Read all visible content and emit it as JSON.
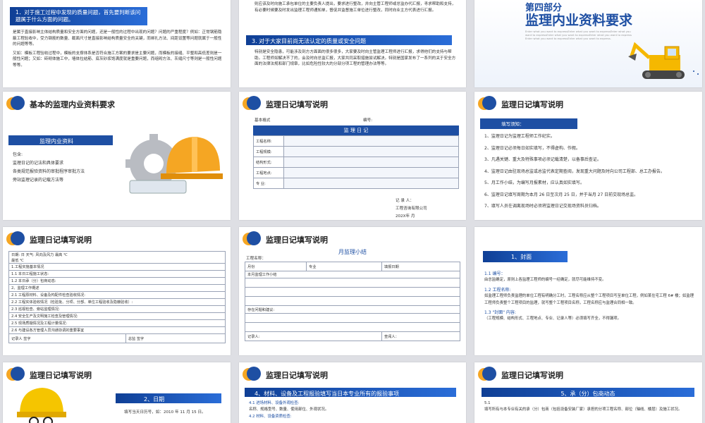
{
  "s1": {
    "heading": "1．对于施工过程中发现的质量问题，首先要判断该问题属于什么方面的问题。",
    "bullets": [
      "是属于直接影响主体结构质量和安全方面的问题，还是一般性的过程中出现的问题？问题的严重程度？例如：正常钢筋隐蔽工程验收中，受力钢筋的数量、截面尺寸是直接影响结构质量安全的关键，而绑扎方法、间距设置等问题就属于一般性的问题等等。",
      "又如：模板工程验收过程中，模板的支撑体系是否符合施工方案的要求是主要问题，而模板的接缝、平整和高低差则是一般性问题；又如：砖砌体施工中，墙体拉结筋、底灰砂浆饱满度就是重要问题，而组砌方法、灰缝尺寸等则是一般性问题等等。"
    ]
  },
  "s2": {
    "top_text": "则应该及时向施工承包单位的主要负责人提出，要求进行整改，并向主管工程师或总监办代汇报，寻求帮助和支持，有必要时候要及时发出监理工程师通知单，督促并监督施工单位进行整改，同时向业主方代表进行汇报。",
    "heading": "3. 对于大家目前尚无法认定的质量或安全问题",
    "body": "特别是安全隐患，可能涉及到方方面面的很多很多，大家要及时向主管监理工程师进行汇报，求得他们的支持与帮助。工程师如解决不了的，会及时向总监汇报，大家共同采取措施尝试解决。特别是国家发布了一系列的关于安全方面的法律法规和部门规章，比如危险性较大的分部分项工程的管理办法等等。"
  },
  "s3": {
    "part_label": "第四部分",
    "title": "监理内业资料要求",
    "subtext": "Enter what you want to expressEnter what you want to expressEnter what you want to expressEnter what you want to expressEnter what you want to express Enter what you want to expressEnter what you want to express."
  },
  "s4": {
    "title": "基本的监理内业资料要求",
    "bar": "监理内业资料",
    "bullets": [
      "包含:",
      "监理日记的记法和具体要求",
      "各类规范报验资料的审批程序审批方法",
      "旁站监理记录的记载方法等"
    ]
  },
  "s5": {
    "title": "监理日记填写说明",
    "format_label": "基本格式",
    "number_label": "编号:",
    "table_title": "监 理 日 记",
    "rows": [
      "工程名称:",
      "工程规模:",
      "结构形式:",
      "工程地点:",
      "专    业:"
    ],
    "recorder": "记 录 人：",
    "company": "工程咨询有限公司",
    "date": "202X年        月"
  },
  "s6": {
    "title": "监理日记填写说明",
    "pill": "填写须知：",
    "items": [
      "1、监理日记为监理工程师工作纪实。",
      "2、监理日记必须每日如实填写，不得虚构、作假。",
      "3、凡遇关键、重大及特殊事项必须记载清楚，以备事后查证。",
      "4、监理日记由驻现场总监或总监代表定期查阅，发现重大问题及时向公司工程部、总工办报告。",
      "5、月工作小结，为编写月报素材，应认真如实填写。",
      "6、监理日记填写周期为本月 26 日至次月 25 日，并于当月 27 日前交现场总监。",
      "7、填写人员在调离现场时必须将监理日记交现场资料员归档。"
    ]
  },
  "s7": {
    "title": "监理日记填写说明",
    "header1": "日期:              日      天气:                风向及风力                    最高      ℃",
    "header2": "最低       ℃",
    "rows": [
      "1.工程实施基本情况",
      "1.1  本日工程施工状态:",
      "1.2  本日承（分）包商动态:",
      "2、监理工作概述",
      "2.1  工程原材料、设备及构配件检查验收情况:",
      "2.2  工程实体验收情况（检验批、分项、分部、单位工程验收及隐蔽验收）:",
      "2.3  巡视检查、旁站监理情况:",
      "2.4  安全生产及文明施工检查及管理情况:",
      "2.5  现场质疑情况及工程计量情况:",
      "2.6  与建设各方管理人员沟通协调的重要事宜"
    ],
    "footer_left": "记录人            签字",
    "footer_right": "总监            签字"
  },
  "s8": {
    "title": "监理日记填写说明",
    "table_title": "月监理小结",
    "name_label": "工程名称：",
    "col1": "月份",
    "col2": "专业",
    "col3": "填报日期",
    "row_a": "本月监理工作小结",
    "row_b": "存在问题和建议:",
    "foot_left": "记录人:",
    "foot_right": "查阅人："
  },
  "s9": {
    "bar": "1、封面",
    "sec1": "1.1  编号：",
    "sec1_text": "由总监确定，原则上各监理工程师的编号一经确定，就尽可能维持不变。",
    "sec2": "1.2  工程名称:",
    "sec2_text": "如监理工程师负责监理的单位工程有明确分工时，工程名称应从整个工程项目写至单位工程，例如某住宅工程 6# 楼；如监理工程师负责整个工程项目的监理，就写整个工程项目名称，工程名称应与监理合同相一致。",
    "sec3": "1.3  \"封面\" 内容:",
    "sec3_text": "（工程规模、结构形式、工程地点、专业、记录人等）必须填写齐全，不得漏项。"
  },
  "s10": {
    "title": "监理日记填写说明",
    "bar": "2、日期",
    "text": "填写当天日历号，如：2010 年 11 月 15 日。"
  },
  "s11": {
    "title": "监理日记填写说明",
    "bar": "4、材料、设备及工程报验填写当日本专业所有的报验事项",
    "line1": "4.1 进场材料、设备外观检查:",
    "line2": "名称、规格型号、数量、使用部位、外观状况。",
    "line3": "4.2 材料、设备资质检查:"
  },
  "s12": {
    "title": "监理日记填写说明",
    "bar": "5、承（分）包商动态",
    "sec": "5.1",
    "text": "填写所有与本专业有关的承（分）包商（包括设备安装厂家）承担的分项工程名称、部位（轴线、楼层）及施工状况。"
  }
}
